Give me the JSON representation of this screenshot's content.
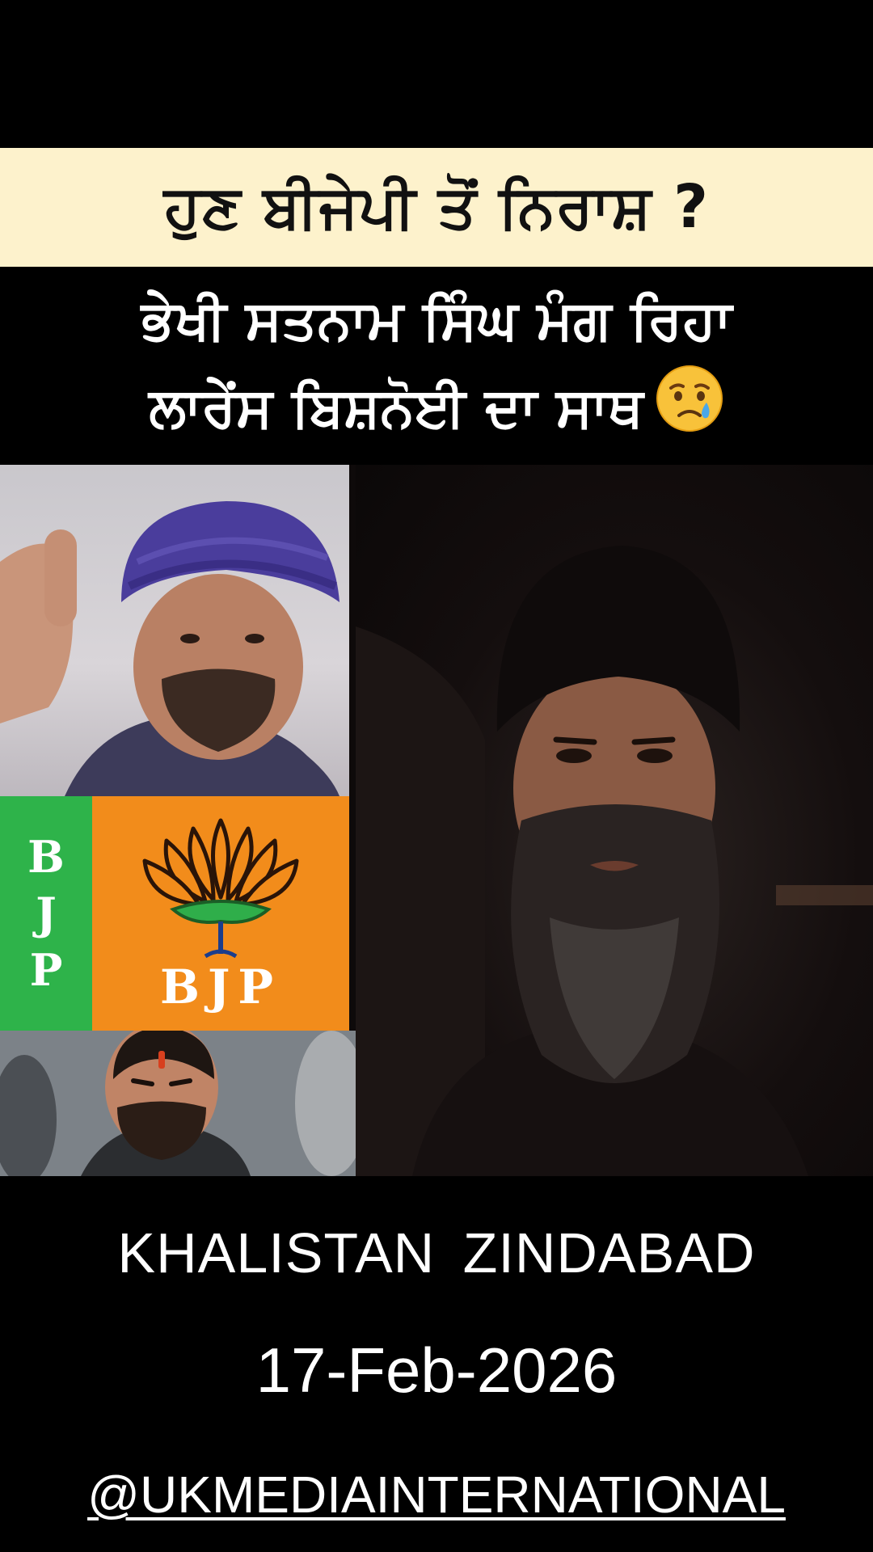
{
  "headline": {
    "text": "ਹੁਣ ਬੀਜੇਪੀ ਤੋਂ ਨਿਰਾਸ਼ ?"
  },
  "subheadline": {
    "line1": "ਭੇਖੀ ਸਤਨਾਮ ਸਿੰਘ ਮੰਗ ਰਿਹਾ",
    "line2": "ਲਾਰੇਂਸ ਬਿਸ਼ਨੋਈ ਦਾ ਸਾਥ",
    "emoji_icon": "crying-face-icon"
  },
  "media": {
    "bjp_card": {
      "side_letters": [
        "B",
        "J",
        "P"
      ],
      "label": "BJP",
      "logo_icon": "lotus-icon",
      "colors": {
        "green": "#2eb34a",
        "orange": "#f28c1b"
      }
    }
  },
  "footer": {
    "tagline": "KHALISTAN  ZINDABAD",
    "date": "17-Feb-2026",
    "handle": "@UKMEDIAINTERNATIONAL"
  },
  "colors": {
    "headline_band": "#fdf2cc",
    "background": "#000000"
  }
}
